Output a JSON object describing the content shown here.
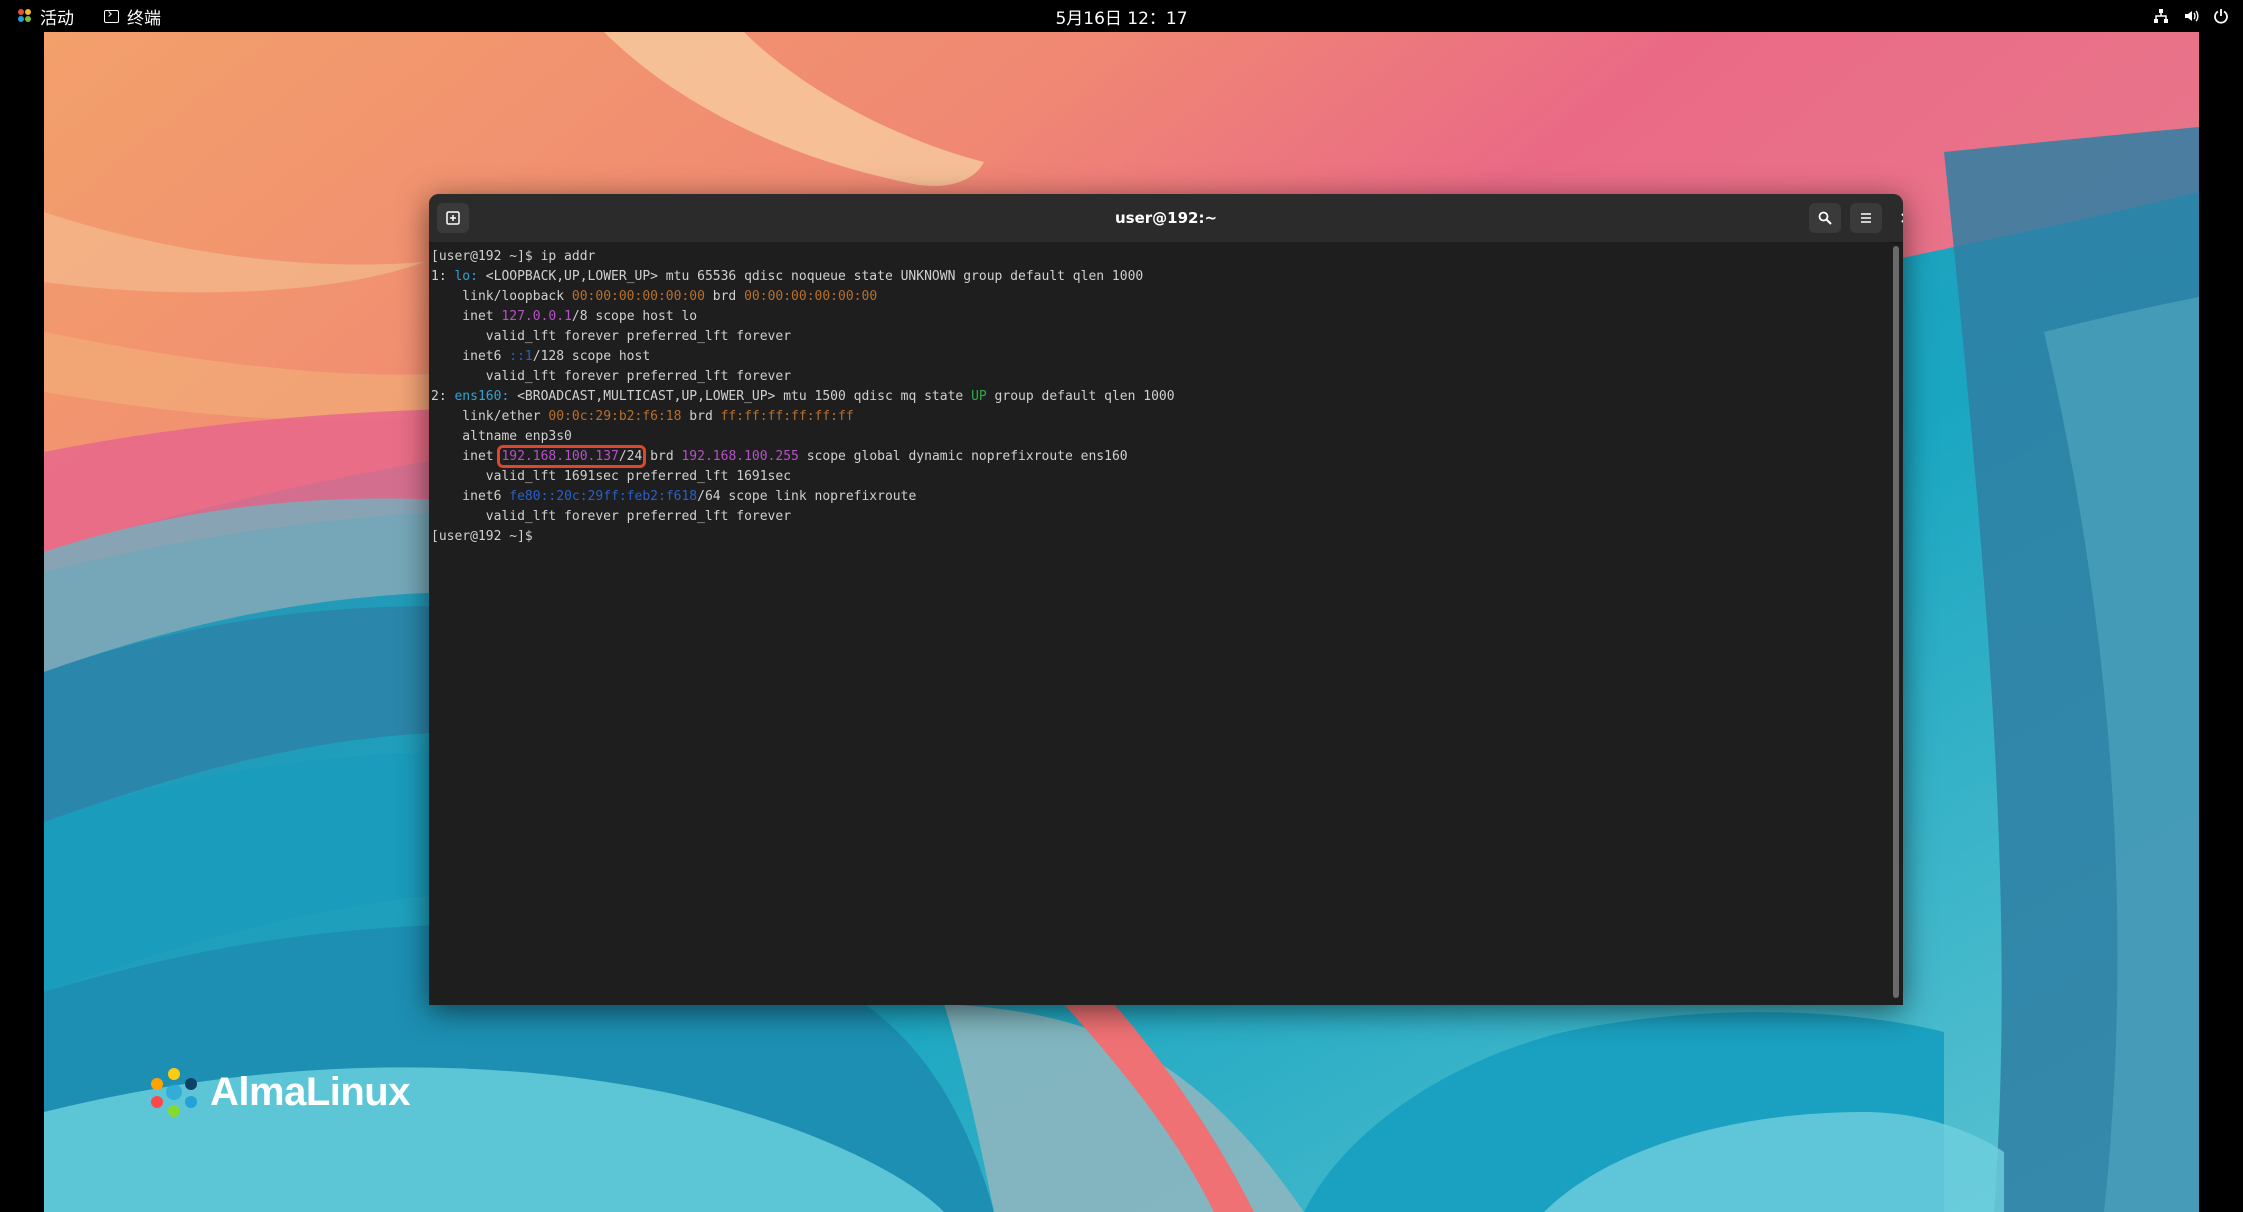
{
  "topbar": {
    "activities_label": "活动",
    "app_label": "终端",
    "clock": "5月16日 12：17",
    "tray_icons": [
      "network-icon",
      "volume-icon",
      "power-icon"
    ]
  },
  "desktop": {
    "logo_text": "AlmaLinux"
  },
  "window": {
    "title": "user@192:~",
    "new_tab_icon": "new-tab-icon",
    "search_icon": "search-icon",
    "menu_icon": "hamburger-menu-icon",
    "close_icon": "close-icon"
  },
  "terminal": {
    "lines": [
      {
        "segments": [
          {
            "t": "[user@192 ~]$ ip addr",
            "c": ""
          }
        ]
      },
      {
        "segments": [
          {
            "t": "1: ",
            "c": ""
          },
          {
            "t": "lo:",
            "c": "cyan"
          },
          {
            "t": " <LOOPBACK,UP,LOWER_UP> mtu 65536 qdisc noqueue state UNKNOWN group default qlen 1000",
            "c": ""
          }
        ]
      },
      {
        "segments": [
          {
            "t": "    link/loopback ",
            "c": ""
          },
          {
            "t": "00:00:00:00:00:00",
            "c": "orange"
          },
          {
            "t": " brd ",
            "c": ""
          },
          {
            "t": "00:00:00:00:00:00",
            "c": "orange"
          }
        ]
      },
      {
        "segments": [
          {
            "t": "    inet ",
            "c": ""
          },
          {
            "t": "127.0.0.1",
            "c": "purple"
          },
          {
            "t": "/8 scope host lo",
            "c": ""
          }
        ]
      },
      {
        "segments": [
          {
            "t": "       valid_lft forever preferred_lft forever",
            "c": ""
          }
        ]
      },
      {
        "segments": [
          {
            "t": "    inet6 ",
            "c": ""
          },
          {
            "t": "::1",
            "c": "blue"
          },
          {
            "t": "/128 scope host",
            "c": ""
          }
        ]
      },
      {
        "segments": [
          {
            "t": "       valid_lft forever preferred_lft forever",
            "c": ""
          }
        ]
      },
      {
        "segments": [
          {
            "t": "2: ",
            "c": ""
          },
          {
            "t": "ens160:",
            "c": "cyan"
          },
          {
            "t": " <BROADCAST,MULTICAST,UP,LOWER_UP> mtu 1500 qdisc mq state ",
            "c": ""
          },
          {
            "t": "UP",
            "c": "green"
          },
          {
            "t": " group default qlen 1000",
            "c": ""
          }
        ]
      },
      {
        "segments": [
          {
            "t": "    link/ether ",
            "c": ""
          },
          {
            "t": "00:0c:29:b2:f6:18",
            "c": "orange"
          },
          {
            "t": " brd ",
            "c": ""
          },
          {
            "t": "ff:ff:ff:ff:ff:ff",
            "c": "orange"
          }
        ]
      },
      {
        "segments": [
          {
            "t": "    altname enp3s0",
            "c": ""
          }
        ]
      },
      {
        "segments": [
          {
            "t": "    inet ",
            "c": ""
          },
          {
            "t": "192.168.100.137",
            "c": "purple",
            "hl": true
          },
          {
            "t": "/24",
            "c": "",
            "hl": true
          },
          {
            "t": " brd ",
            "c": ""
          },
          {
            "t": "192.168.100.255",
            "c": "purple"
          },
          {
            "t": " scope global dynamic noprefixroute ens160",
            "c": ""
          }
        ]
      },
      {
        "segments": [
          {
            "t": "       valid_lft 1691sec preferred_lft 1691sec",
            "c": ""
          }
        ]
      },
      {
        "segments": [
          {
            "t": "    inet6 ",
            "c": ""
          },
          {
            "t": "fe80::20c:29ff:feb2:f618",
            "c": "blue"
          },
          {
            "t": "/64 scope link noprefixroute",
            "c": ""
          }
        ]
      },
      {
        "segments": [
          {
            "t": "       valid_lft forever preferred_lft forever",
            "c": ""
          }
        ]
      },
      {
        "segments": [
          {
            "t": "[user@192 ~]$ ",
            "c": ""
          }
        ]
      }
    ]
  },
  "colors": {
    "cyan": "#2fa4d6",
    "orange": "#b7702e",
    "purple": "#b552c7",
    "blue": "#2960c8",
    "green": "#2faa46",
    "highlight_box": "#e0452e"
  }
}
